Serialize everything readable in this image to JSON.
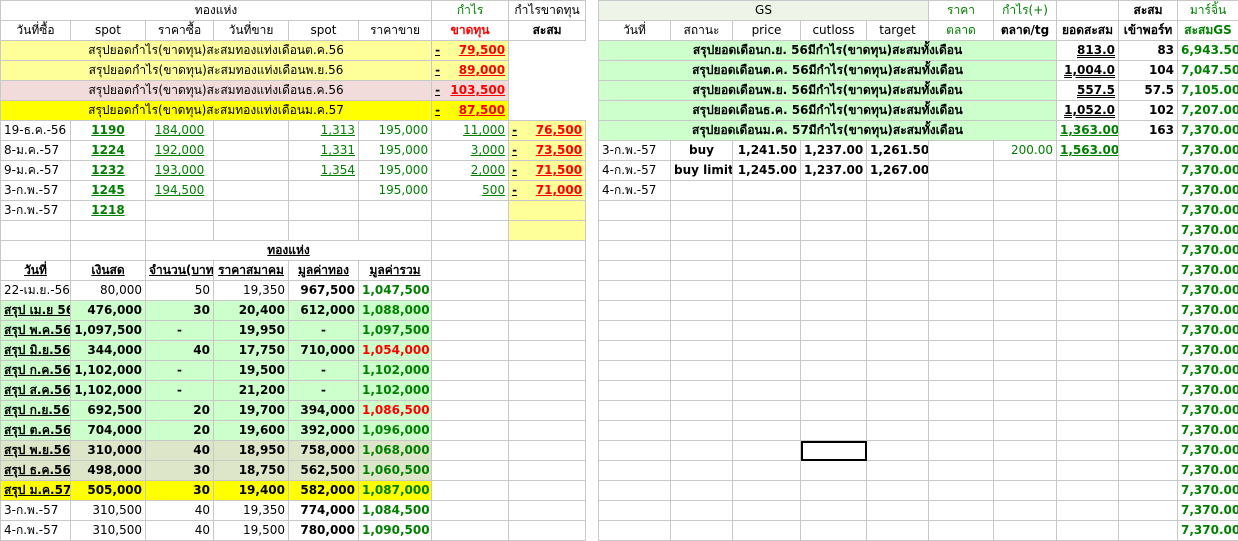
{
  "left": {
    "header1": {
      "gold": "ทองแห่ง",
      "profit": "กำไร",
      "profit_loss": "กำไรขาดทุน"
    },
    "header2": [
      "วันที่ซื้อ",
      "spot",
      "ราคาซื้อ",
      "วันที่ขาย",
      "spot",
      "ราคาขาย",
      "ขาดทุน",
      "สะสม"
    ],
    "summaries": [
      {
        "text": "สรุปยอดกำไร(ขาดทุน)สะสมทองแท่งเดือนต.ค.56",
        "sign": "-",
        "value": "79,500",
        "bg": "y"
      },
      {
        "text": "สรุปยอดกำไร(ขาดทุน)สะสมทองแท่งเดือนพ.ย.56",
        "sign": "-",
        "value": "89,000",
        "bg": "y"
      },
      {
        "text": "สรุปยอดกำไร(ขาดทุน)สะสมทองแท่งเดือนธ.ค.56",
        "sign": "-",
        "value": "103,500",
        "bg": "pk"
      },
      {
        "text": "สรุปยอดกำไร(ขาดทุน)สะสมทองแท่งเดือนม.ค.57",
        "sign": "-",
        "value": "87,500",
        "bg": "y2"
      }
    ],
    "trades": [
      {
        "date": "19-ธ.ค.-56",
        "spot": "1190",
        "buy": "184,000",
        "sell_date": "",
        "sell_spot": "1,313",
        "sell_price": "195,000",
        "profit": "11,000",
        "sign": "-",
        "cum": "76,500"
      },
      {
        "date": "8-ม.ค.-57",
        "spot": "1224",
        "buy": "192,000",
        "sell_date": "",
        "sell_spot": "1,331",
        "sell_price": "195,000",
        "profit": "3,000",
        "sign": "-",
        "cum": "73,500"
      },
      {
        "date": "9-ม.ค.-57",
        "spot": "1232",
        "buy": "193,000",
        "sell_date": "",
        "sell_spot": "1,354",
        "sell_price": "195,000",
        "profit": "2,000",
        "sign": "-",
        "cum": "71,500"
      },
      {
        "date": "3-ก.พ.-57",
        "spot": "1245",
        "buy": "194,500",
        "sell_date": "",
        "sell_spot": "",
        "sell_price": "195,000",
        "profit": "500",
        "sign": "-",
        "cum": "71,000"
      },
      {
        "date": "3-ก.พ.-57",
        "spot": "1218",
        "buy": "",
        "sell_date": "",
        "sell_spot": "",
        "sell_price": "",
        "profit": "",
        "sign": "",
        "cum": ""
      }
    ],
    "sec2_title": "ทองแห่ง",
    "sec2_headers": [
      "วันที่",
      "เงินสด",
      "จำนวน(บาท",
      "ราคาสมาคม",
      "มูลค่าทอง",
      "มูลค่ารวม"
    ],
    "holdings": [
      {
        "date": "22-เม.ย.-56",
        "cash": "80,000",
        "qty": "50",
        "price": "19,350",
        "gold": "967,500",
        "total": "1,047,500",
        "bold": false,
        "bg": "",
        "red": false
      },
      {
        "date": "สรุป เม.ย 56",
        "cash": "476,000",
        "qty": "30",
        "price": "20,400",
        "gold": "612,000",
        "total": "1,088,000",
        "bold": true,
        "bg": "gl",
        "red": false
      },
      {
        "date": "สรุป พ.ค.56",
        "cash": "1,097,500",
        "qty": "-",
        "price": "19,950",
        "gold": "-",
        "total": "1,097,500",
        "bold": true,
        "bg": "gl",
        "red": false
      },
      {
        "date": "สรุป มิ.ย.56",
        "cash": "344,000",
        "qty": "40",
        "price": "17,750",
        "gold": "710,000",
        "total": "1,054,000",
        "bold": true,
        "bg": "gl",
        "red": true
      },
      {
        "date": "สรุป ก.ค.56",
        "cash": "1,102,000",
        "qty": "-",
        "price": "19,500",
        "gold": "-",
        "total": "1,102,000",
        "bold": true,
        "bg": "gl",
        "red": false
      },
      {
        "date": "สรุป ส.ค.56",
        "cash": "1,102,000",
        "qty": "-",
        "price": "21,200",
        "gold": "-",
        "total": "1,102,000",
        "bold": true,
        "bg": "gl",
        "red": false
      },
      {
        "date": "สรุป ก.ย.56",
        "cash": "692,500",
        "qty": "20",
        "price": "19,700",
        "gold": "394,000",
        "total": "1,086,500",
        "bold": true,
        "bg": "gl",
        "red": true
      },
      {
        "date": "สรุป ต.ค.56",
        "cash": "704,000",
        "qty": "20",
        "price": "19,600",
        "gold": "392,000",
        "total": "1,096,000",
        "bold": true,
        "bg": "gl",
        "red": false
      },
      {
        "date": "สรุป พ.ย.56",
        "cash": "310,000",
        "qty": "40",
        "price": "18,950",
        "gold": "758,000",
        "total": "1,068,000",
        "bold": true,
        "bg": "ch",
        "red": false
      },
      {
        "date": "สรุป ธ.ค.56",
        "cash": "498,000",
        "qty": "30",
        "price": "18,750",
        "gold": "562,500",
        "total": "1,060,500",
        "bold": true,
        "bg": "ch",
        "red": false
      },
      {
        "date": "สรุป ม.ค.57",
        "cash": "505,000",
        "qty": "30",
        "price": "19,400",
        "gold": "582,000",
        "total": "1,087,000",
        "bold": true,
        "bg": "y2",
        "red": false
      },
      {
        "date": "3-ก.พ.-57",
        "cash": "310,500",
        "qty": "40",
        "price": "19,350",
        "gold": "774,000",
        "total": "1,084,500",
        "bold": false,
        "bg": "",
        "red": false
      },
      {
        "date": "4-ก.พ.-57",
        "cash": "310,500",
        "qty": "40",
        "price": "19,500",
        "gold": "780,000",
        "total": "1,090,500",
        "bold": false,
        "bg": "",
        "red": false
      }
    ]
  },
  "right": {
    "header1": {
      "gs": "GS",
      "price": "ราคา",
      "profit": "กำไร(+)",
      "cum": "สะสม",
      "margin": "มาร์จิ้น"
    },
    "header2": [
      "วันที่",
      "สถานะ",
      "price",
      "cutloss",
      "target",
      "ตลาด",
      "ตลาด/tg",
      "ยอดสะสม",
      "เข้าพอร์ท",
      "สะสมGS"
    ],
    "summaries": [
      {
        "text": "สรุปยอดเดือนก.ย. 56มีกำไร(ขาดทุน)สะสมทั้งเดือน",
        "cum": "813.0",
        "port": "83",
        "gs": "6,943.50"
      },
      {
        "text": "สรุปยอดเดือนต.ค. 56มีกำไร(ขาดทุน)สะสมทั้งเดือน",
        "cum": "1,004.0",
        "port": "104",
        "gs": "7,047.50"
      },
      {
        "text": "สรุปยอดเดือนพ.ย. 56มีกำไร(ขาดทุน)สะสมทั้งเดือน",
        "cum": "557.5",
        "port": "57.5",
        "gs": "7,105.00"
      },
      {
        "text": "สรุปยอดเดือนธ.ค. 56มีกำไร(ขาดทุน)สะสมทั้งเดือน",
        "cum": "1,052.0",
        "port": "102",
        "gs": "7,207.00"
      },
      {
        "text": "สรุปยอดเดือนม.ค. 57มีกำไร(ขาดทุน)สะสมทั้งเดือน",
        "cum": "1,363.00",
        "port": "163",
        "gs": "7,370.00"
      }
    ],
    "trades": [
      {
        "date": "3-ก.พ.-57",
        "status": "buy",
        "price": "1,241.50",
        "cutloss": "1,237.00",
        "target": "1,261.50",
        "market": "",
        "profit": "200.00",
        "cum": "1,563.00",
        "gs": "7,370.00"
      },
      {
        "date": "4-ก.พ.-57",
        "status": "buy limit",
        "price": "1,245.00",
        "cutloss": "1,237.00",
        "target": "1,267.00",
        "market": "",
        "profit": "",
        "cum": "",
        "gs": "7,370.00"
      },
      {
        "date": "4-ก.พ.-57",
        "status": "",
        "price": "",
        "cutloss": "",
        "target": "",
        "market": "",
        "profit": "",
        "cum": "",
        "gs": "7,370.00"
      }
    ],
    "fill_gs": "7,370.00"
  }
}
